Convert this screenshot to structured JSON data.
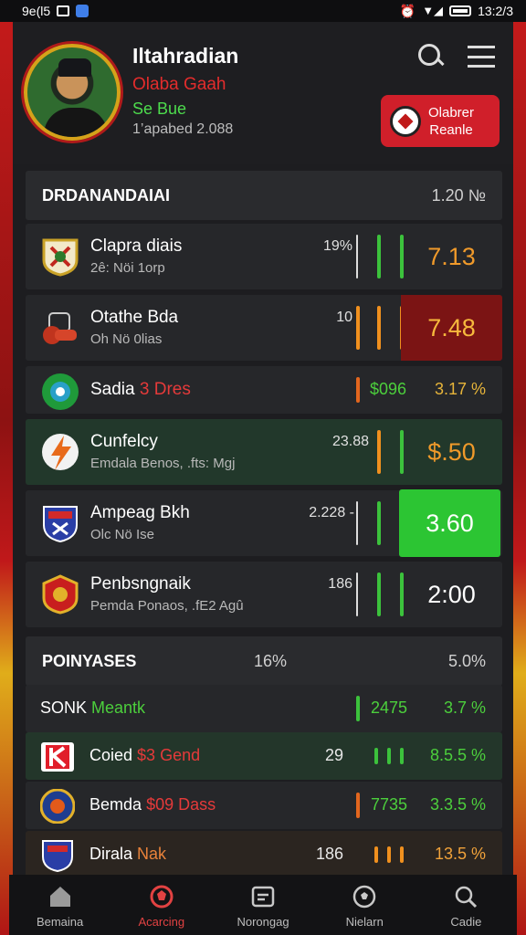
{
  "status_bar": {
    "left_text": "9e(l5",
    "time": "13:2/3"
  },
  "profile": {
    "name": "Iltahradian",
    "club": "Olaba Gaah",
    "tag": "Se Bue",
    "stat": "1’apabed 2.088",
    "cta_label_line1": "Olabrer",
    "cta_label_line2": "Reanle"
  },
  "section_main": {
    "title": "DRDANANDAIAI",
    "value": "1.20 №"
  },
  "matches": [
    {
      "name": "Clapra diais",
      "sub": "2ê: Nöi 1orp",
      "pct": "19%",
      "odds": "7.13"
    },
    {
      "name": "Otathe Bda",
      "sub": "Oh Nö 0lias",
      "pct": "10",
      "odds": "7.48"
    },
    {
      "name_white": "Sadia",
      "name_red": "3 Dres",
      "v1": "$096",
      "odds": "3.17 %"
    },
    {
      "name": "Cunfelcy",
      "sub": "Emdala Benos, .fts: Mgj",
      "pct": "23.88",
      "odds": "$.50"
    },
    {
      "name": "Ampeag Bkh",
      "sub": "Olc Nö Ise",
      "pct": "2.228 -",
      "odds": "3.60"
    },
    {
      "name": "Penbsngnaik",
      "sub": "Pemda Ponaos, .fE2 Agû",
      "pct": "186",
      "odds": "2:00"
    }
  ],
  "section_pos": {
    "title": "POINYASES",
    "mid": "16%",
    "value": "5.0%"
  },
  "positions": [
    {
      "lead": "SONK",
      "name_green": "Meantk",
      "n2": "2475",
      "n3": "3.7 %"
    },
    {
      "name_white": "Coied",
      "name_red": "$3 Gend",
      "n1": "29",
      "n3": "8.5.5 %"
    },
    {
      "name_white": "Bemda",
      "name_red": "$09 Dass",
      "n2": "7735",
      "n3": "3.3.5 %"
    },
    {
      "name_white": "Dirala",
      "name_red": "Nak",
      "n1": "186",
      "n3": "13.5 %"
    }
  ],
  "nav": [
    {
      "label": "Bemaina",
      "icon": "home-icon"
    },
    {
      "label": "Acarcing",
      "icon": "soccer-shield-icon"
    },
    {
      "label": "Norongag",
      "icon": "ticket-icon"
    },
    {
      "label": "Nielarn",
      "icon": "ball-icon"
    },
    {
      "label": "Cadie",
      "icon": "search-icon"
    }
  ],
  "colors": {
    "accent_red": "#d01f2a",
    "accent_green": "#2cc533",
    "odds_orange": "#f0a23a"
  }
}
